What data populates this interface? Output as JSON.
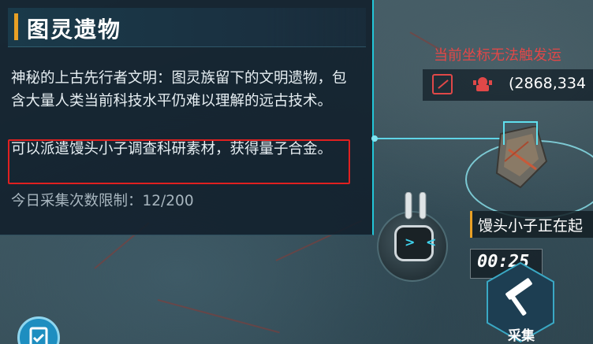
{
  "panel": {
    "title": "图灵遗物",
    "description": "神秘的上古先行者文明：图灵族留下的文明遗物，包含大量人类当前科技水平仍难以理解的远古技术。",
    "highlight": "可以派遣馒头小子调查科研素材，获得量子合金。",
    "limit_label": "今日采集次数限制：12/200"
  },
  "map": {
    "warning": "当前坐标无法触发运",
    "coordinates": "(2868,334"
  },
  "robot": {
    "eyes": "> <"
  },
  "status": {
    "text": "馒头小子正在起",
    "timer": "00:25"
  },
  "actions": {
    "collect_label": "采集"
  },
  "colors": {
    "accent": "#22c6d8",
    "title_bar": "#e8a025",
    "warning": "#e04848",
    "highlight_border": "#e02020"
  }
}
